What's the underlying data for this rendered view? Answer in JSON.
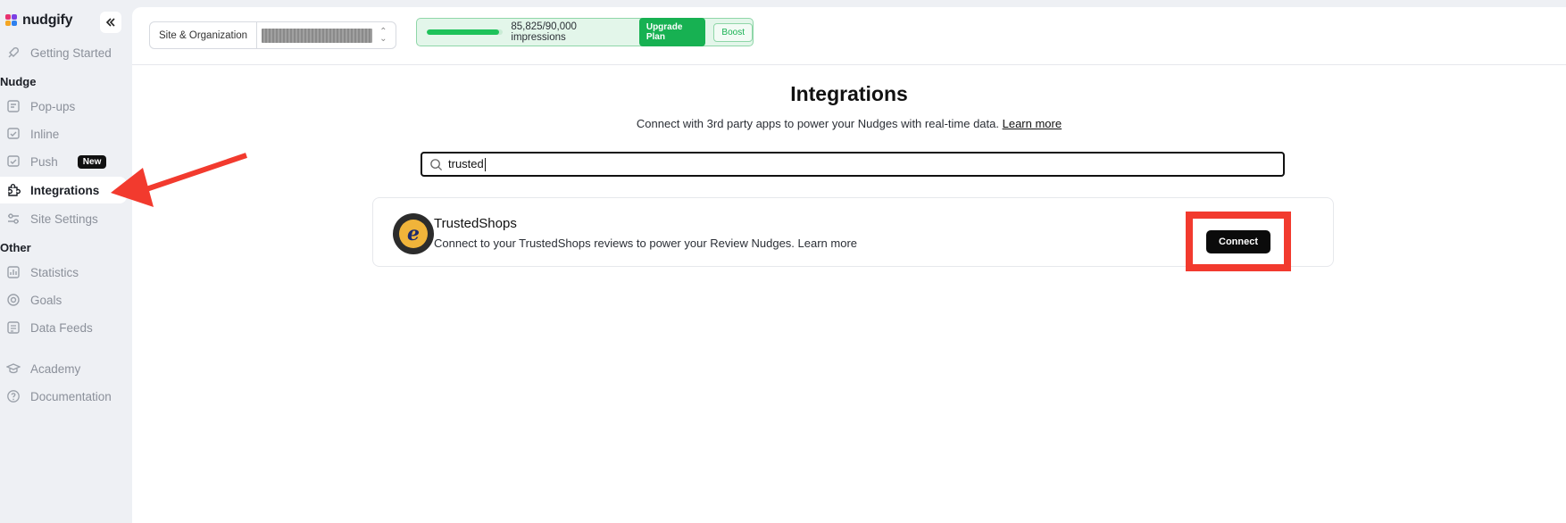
{
  "app": {
    "brand": "nudgify"
  },
  "sidebar": {
    "top_items": [
      {
        "label": "Getting Started",
        "icon": "rocket-icon"
      }
    ],
    "sections": [
      {
        "title": "Nudge",
        "items": [
          {
            "label": "Pop-ups",
            "icon": "popup-icon"
          },
          {
            "label": "Inline",
            "icon": "inline-icon"
          },
          {
            "label": "Push",
            "icon": "push-icon",
            "badge": "New"
          },
          {
            "label": "Integrations",
            "icon": "puzzle-icon",
            "active": true
          },
          {
            "label": "Site Settings",
            "icon": "sliders-icon"
          }
        ]
      },
      {
        "title": "Other",
        "items": [
          {
            "label": "Statistics",
            "icon": "chart-icon"
          },
          {
            "label": "Goals",
            "icon": "target-icon"
          },
          {
            "label": "Data Feeds",
            "icon": "feed-icon"
          }
        ]
      }
    ],
    "bottom_items": [
      {
        "label": "Academy",
        "icon": "graduation-cap-icon"
      },
      {
        "label": "Documentation",
        "icon": "help-circle-icon"
      }
    ]
  },
  "topbar": {
    "site_label": "Site & Organization",
    "impressions": {
      "text": "85,825/90,000 impressions",
      "used": 85825,
      "limit": 90000
    },
    "upgrade_label": "Upgrade Plan",
    "boost_label": "Boost"
  },
  "page": {
    "title": "Integrations",
    "subtitle": "Connect with 3rd party apps to power your Nudges with real-time data.",
    "learn_more": "Learn more"
  },
  "search": {
    "value": "trusted"
  },
  "results": [
    {
      "name": "TrustedShops",
      "description": "Connect to your TrustedShops reviews to power your Review Nudges. Learn more",
      "button": "Connect"
    }
  ],
  "colors": {
    "accent_green": "#17b152",
    "annotation_red": "#f23a2e"
  }
}
